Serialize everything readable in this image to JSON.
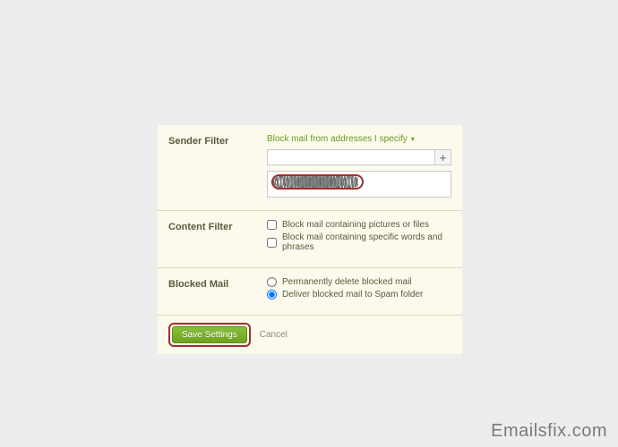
{
  "sender_filter": {
    "label": "Sender Filter",
    "dropdown": "Block mail from addresses I specify",
    "address_input": "",
    "blocked_display": "[redacted]"
  },
  "content_filter": {
    "label": "Content Filter",
    "option1": "Block mail containing pictures or files",
    "option2": "Block mail containing specific words and phrases"
  },
  "blocked_mail": {
    "label": "Blocked Mail",
    "option1": "Permanently delete blocked mail",
    "option2": "Deliver blocked mail to Spam folder"
  },
  "footer": {
    "save": "Save Settings",
    "cancel": "Cancel"
  },
  "watermark": "Emailsfix.com"
}
